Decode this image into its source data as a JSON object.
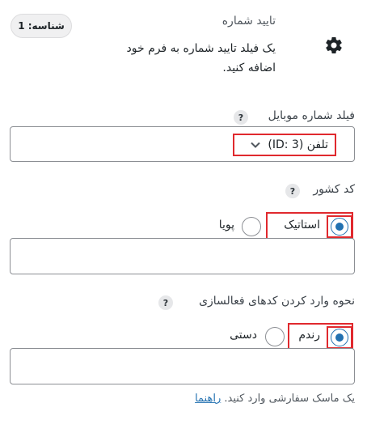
{
  "header": {
    "badge_label": "شناسه: 1",
    "title": "تایید شماره",
    "description": "یک فیلد تایید شماره به فرم خود اضافه کنید."
  },
  "mobile_field": {
    "label": "فیلد شماره موبایل",
    "help": "?",
    "selected_value": "تلفن (ID: 3)"
  },
  "country_code": {
    "label": "کد کشور",
    "help": "?",
    "options": [
      {
        "label": "استاتیک",
        "checked": true
      },
      {
        "label": "پویا",
        "checked": false
      }
    ],
    "input_value": ""
  },
  "activation": {
    "label": "نحوه وارد کردن کدهای فعالسازی",
    "help": "?",
    "options": [
      {
        "label": "رندم",
        "checked": true
      },
      {
        "label": "دستی",
        "checked": false
      }
    ],
    "input_value": ""
  },
  "hint": {
    "text": "یک ماسک سفارشی وارد کنید.",
    "link": "راهنما"
  },
  "colors": {
    "accent": "#2271b1",
    "highlight": "#e0292e",
    "border": "#8c8f94"
  }
}
